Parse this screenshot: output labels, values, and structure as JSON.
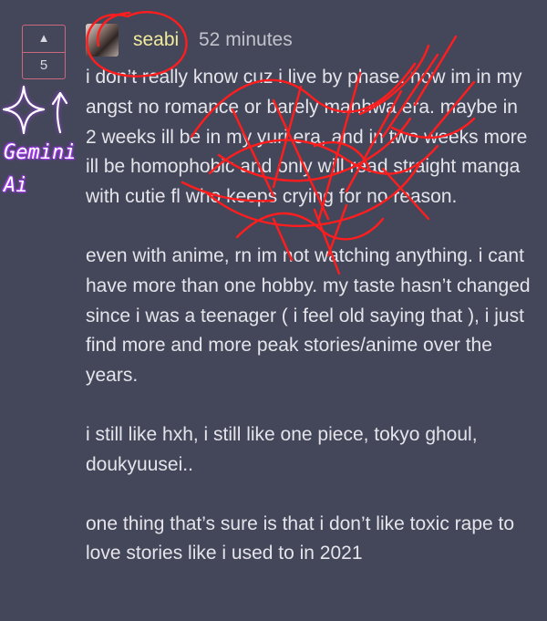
{
  "vote": {
    "up_arrow": "▲",
    "count": "5"
  },
  "post": {
    "username": "seabi",
    "timestamp": "52 minutes",
    "paragraphs": [
      "i don’t really know cuz i live by phase. now im in my angst no romance or barely manhwa era. maybe in 2 weeks ill be in my yuri era, and in two weeks more ill be homophobic and only will read straight manga with cutie fl who keeps crying for no reason.",
      "even with anime, rn im not watching anything. i cant have more than one hobby. my taste hasn’t changed since i was a teenager ( i feel old saying that ), i just find more and more peak stories/anime over the years.",
      "i still like hxh, i still like one piece, tokyo ghoul, doukyuusei..",
      "one thing that’s sure is that i don’t like toxic rape to love stories like i used to in 2021"
    ]
  },
  "annotation": {
    "sticker_text": "Gemini\nAi",
    "colors": {
      "scribble": "#ff1d1d",
      "sticker": "#9d3be8"
    }
  }
}
